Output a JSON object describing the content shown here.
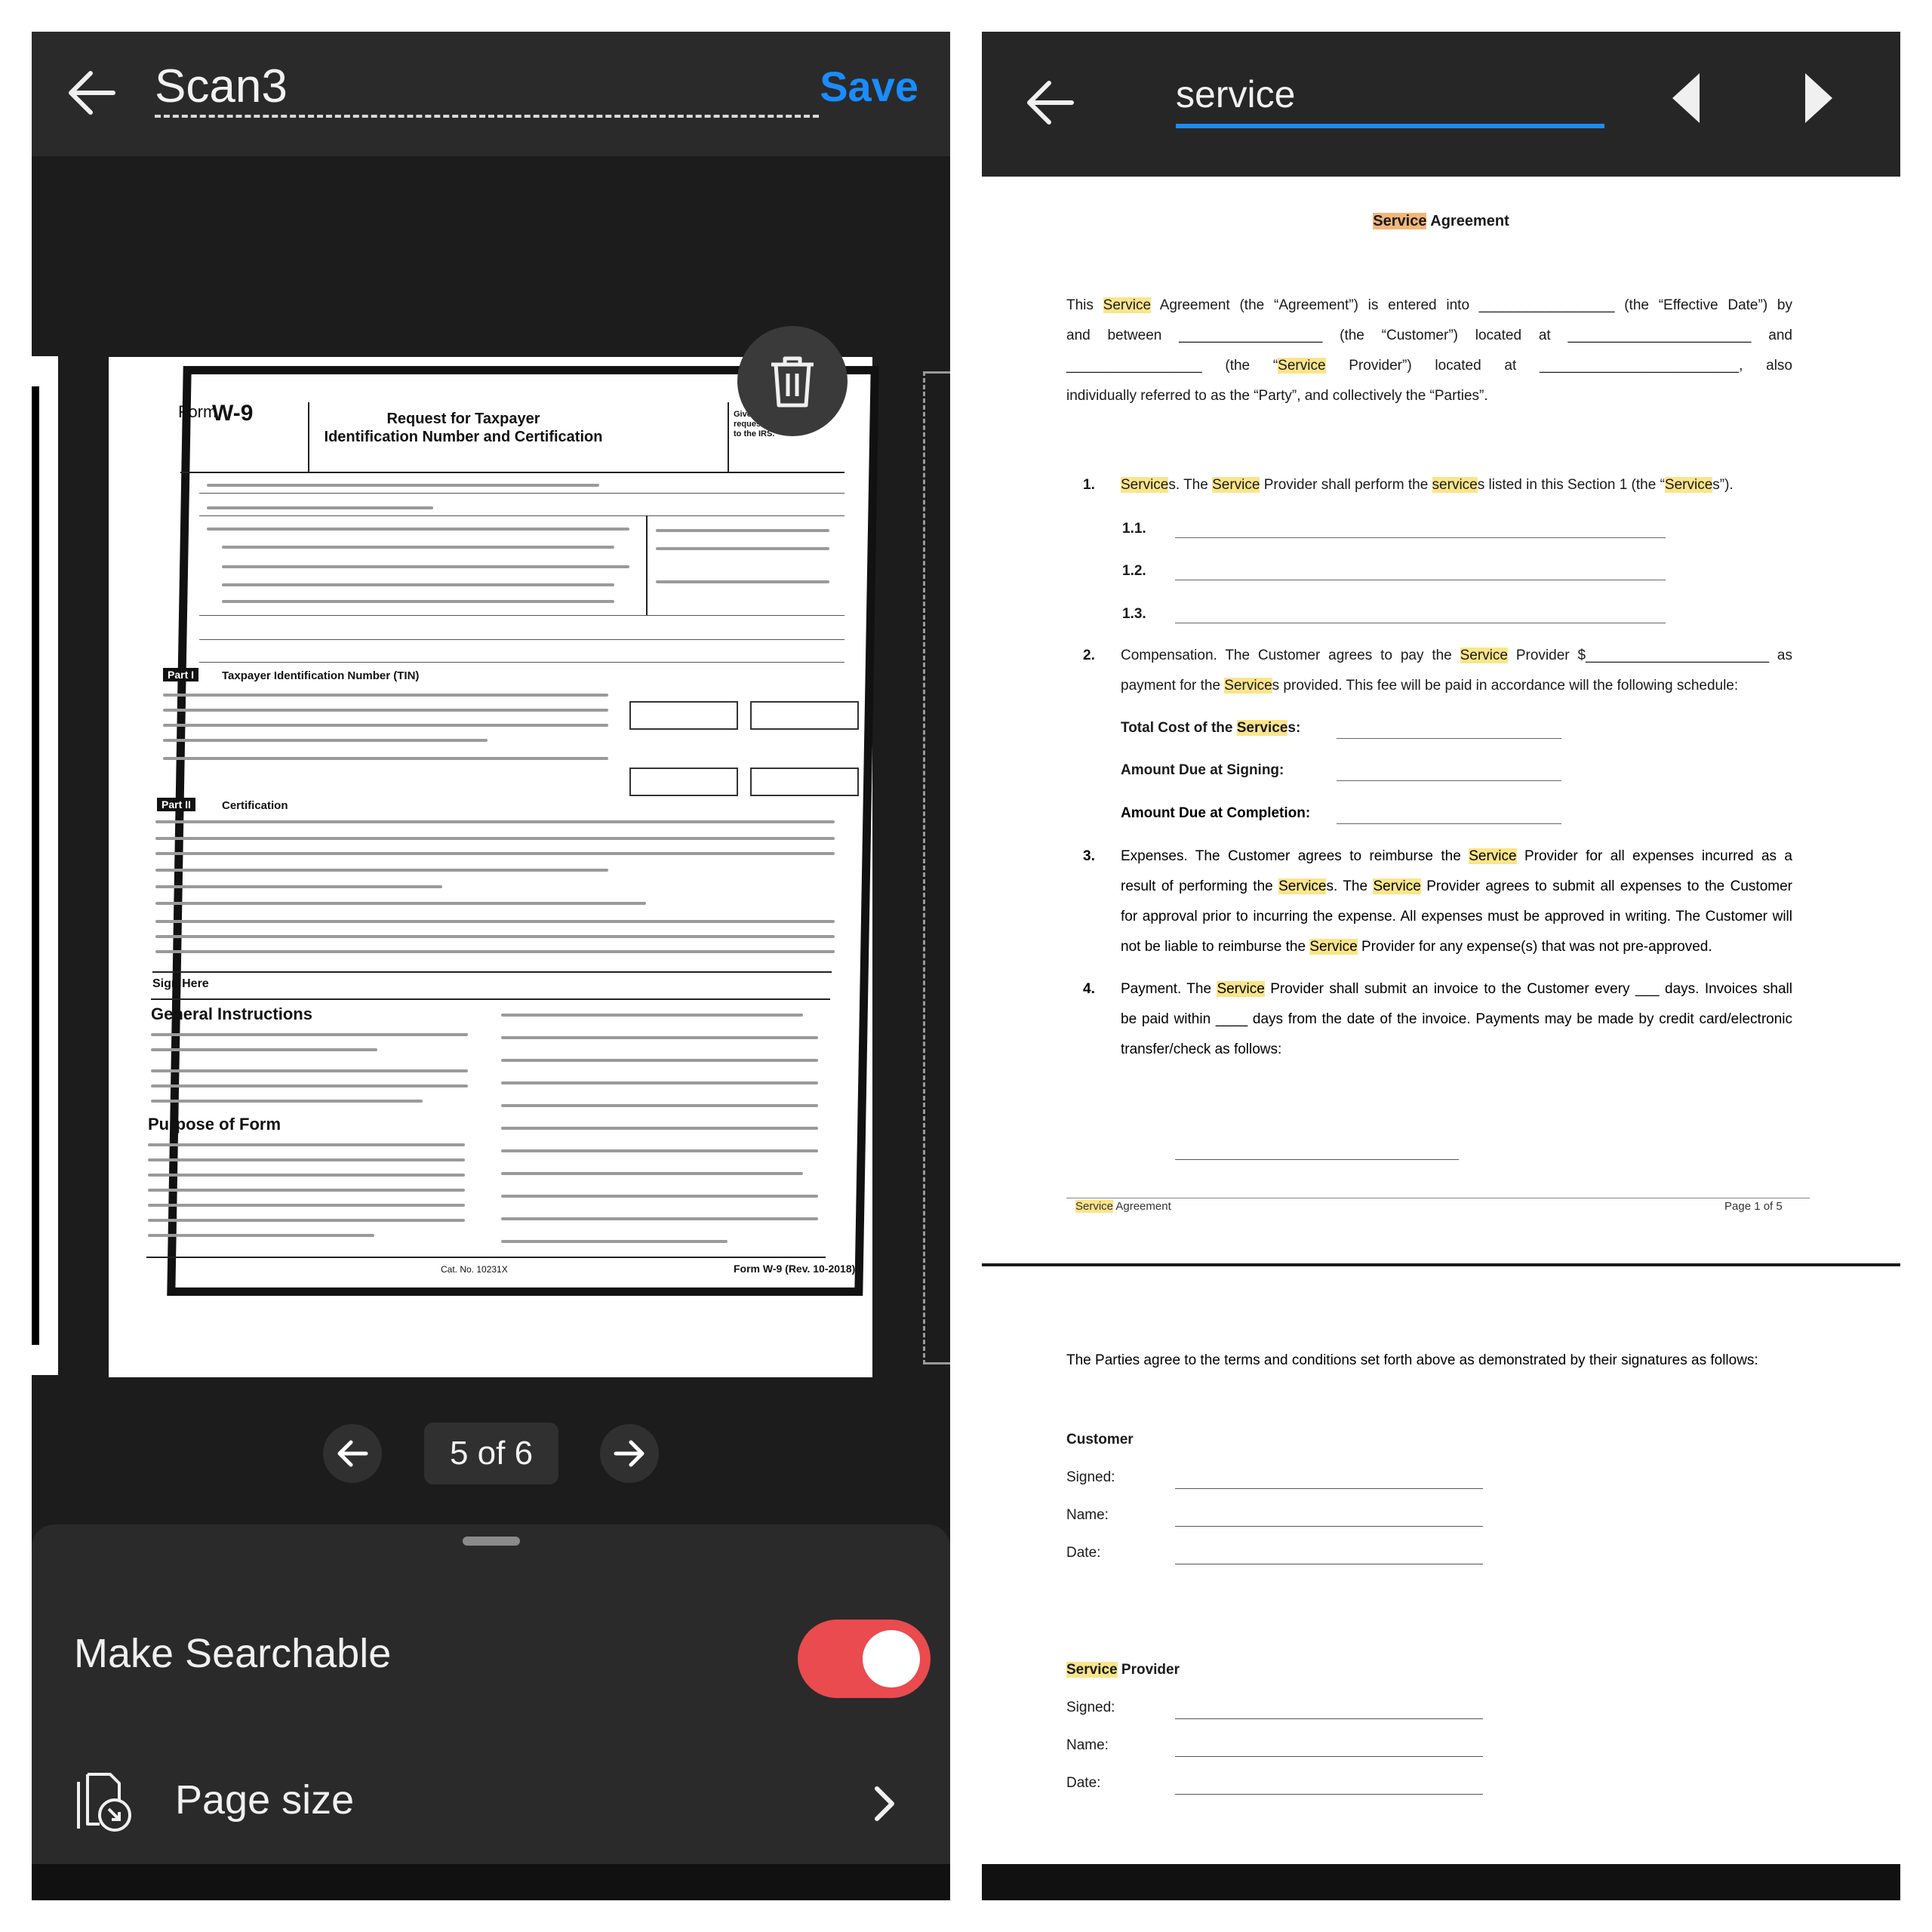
{
  "scanner": {
    "title": "Scan3",
    "save_label": "Save",
    "page_indicator": "5 of 6",
    "make_searchable_label": "Make Searchable",
    "make_searchable_on": true,
    "page_size_label": "Page size",
    "accent_color": "#1a8cff",
    "toggle_color": "#e94b4f",
    "icons": [
      "back-arrow-icon",
      "trash-icon",
      "arrow-left-icon",
      "arrow-right-icon",
      "page-size-icon",
      "chevron-right-icon"
    ],
    "w9": {
      "form_label": "Form",
      "form_number": "W-9",
      "title_line1": "Request for Taxpayer",
      "title_line2": "Identification Number and Certification",
      "side_note": "Give Form to the requester. Do not send to the IRS.",
      "part1_label": "Part I",
      "part1_title": "Taxpayer Identification Number (TIN)",
      "part2_label": "Part II",
      "part2_title": "Certification",
      "sign_here": "Sign Here",
      "general_instructions": "General Instructions",
      "purpose_of_form": "Purpose of Form",
      "cat_no": "Cat. No. 10231X",
      "footer": "Form W-9 (Rev. 10-2018)"
    }
  },
  "search_view": {
    "query": "service",
    "icons": [
      "back-arrow-icon",
      "previous-result-icon",
      "next-result-icon"
    ],
    "highlight_color": "#fbe58a",
    "current_highlight_color": "#f5b676",
    "page1": {
      "title_hit": "Service",
      "title_rest": " Agreement",
      "intro": {
        "line1": "This Service Agreement (the “Agreement”) is entered into _________________ (the “Effective Date”) by",
        "line2": "and between __________________ (the “Customer”) located at _______________________ and",
        "line3": "_________________ (the “Service Provider”) located at _________________________, also",
        "line4": "individually referred to as the “Party”, and collectively the “Parties”."
      },
      "sections": {
        "s1_num": "1.",
        "s1_text": "Services. The Service Provider shall perform the services listed in this Section 1 (the “Services”).",
        "s1_items": [
          "1.1.",
          "1.2.",
          "1.3."
        ],
        "s2_num": "2.",
        "s2_line1": "Compensation. The Customer agrees to pay the Service Provider $_______________________ as",
        "s2_line2": "payment for the Services provided. This fee will be paid in accordance will the following schedule:",
        "total_cost": "Total Cost of the Services:",
        "amount_signing": "Amount Due at Signing:",
        "amount_completion": "Amount Due at Completion:",
        "s3_num": "3.",
        "s3_line1": "Expenses. The Customer agrees to reimburse the Service Provider for all expenses incurred as a",
        "s3_line2": "result of performing the Services. The Service Provider agrees to submit all expenses to the Customer",
        "s3_line3": "for approval prior to incurring the expense. All expenses must be approved in writing. The Customer will",
        "s3_line4": "not be liable to reimburse the Service Provider for any expense(s) that was not pre-approved.",
        "s4_num": "4.",
        "s4_line1": "Payment. The Service Provider shall submit an invoice to the Customer every ___ days. Invoices shall",
        "s4_line2": "be paid within ____ days from the date of the invoice. Payments may be made by credit card/electronic",
        "s4_line3": "transfer/check as follows:"
      },
      "footer_left": "Service Agreement",
      "footer_right": "Page 1 of 5"
    },
    "page2": {
      "agree_text": "The Parties agree to the terms and conditions set forth above as demonstrated by their signatures as follows:",
      "customer_heading": "Customer",
      "provider_heading": "Service Provider",
      "signed_label": "Signed:",
      "name_label": "Name:",
      "date_label": "Date:"
    }
  }
}
